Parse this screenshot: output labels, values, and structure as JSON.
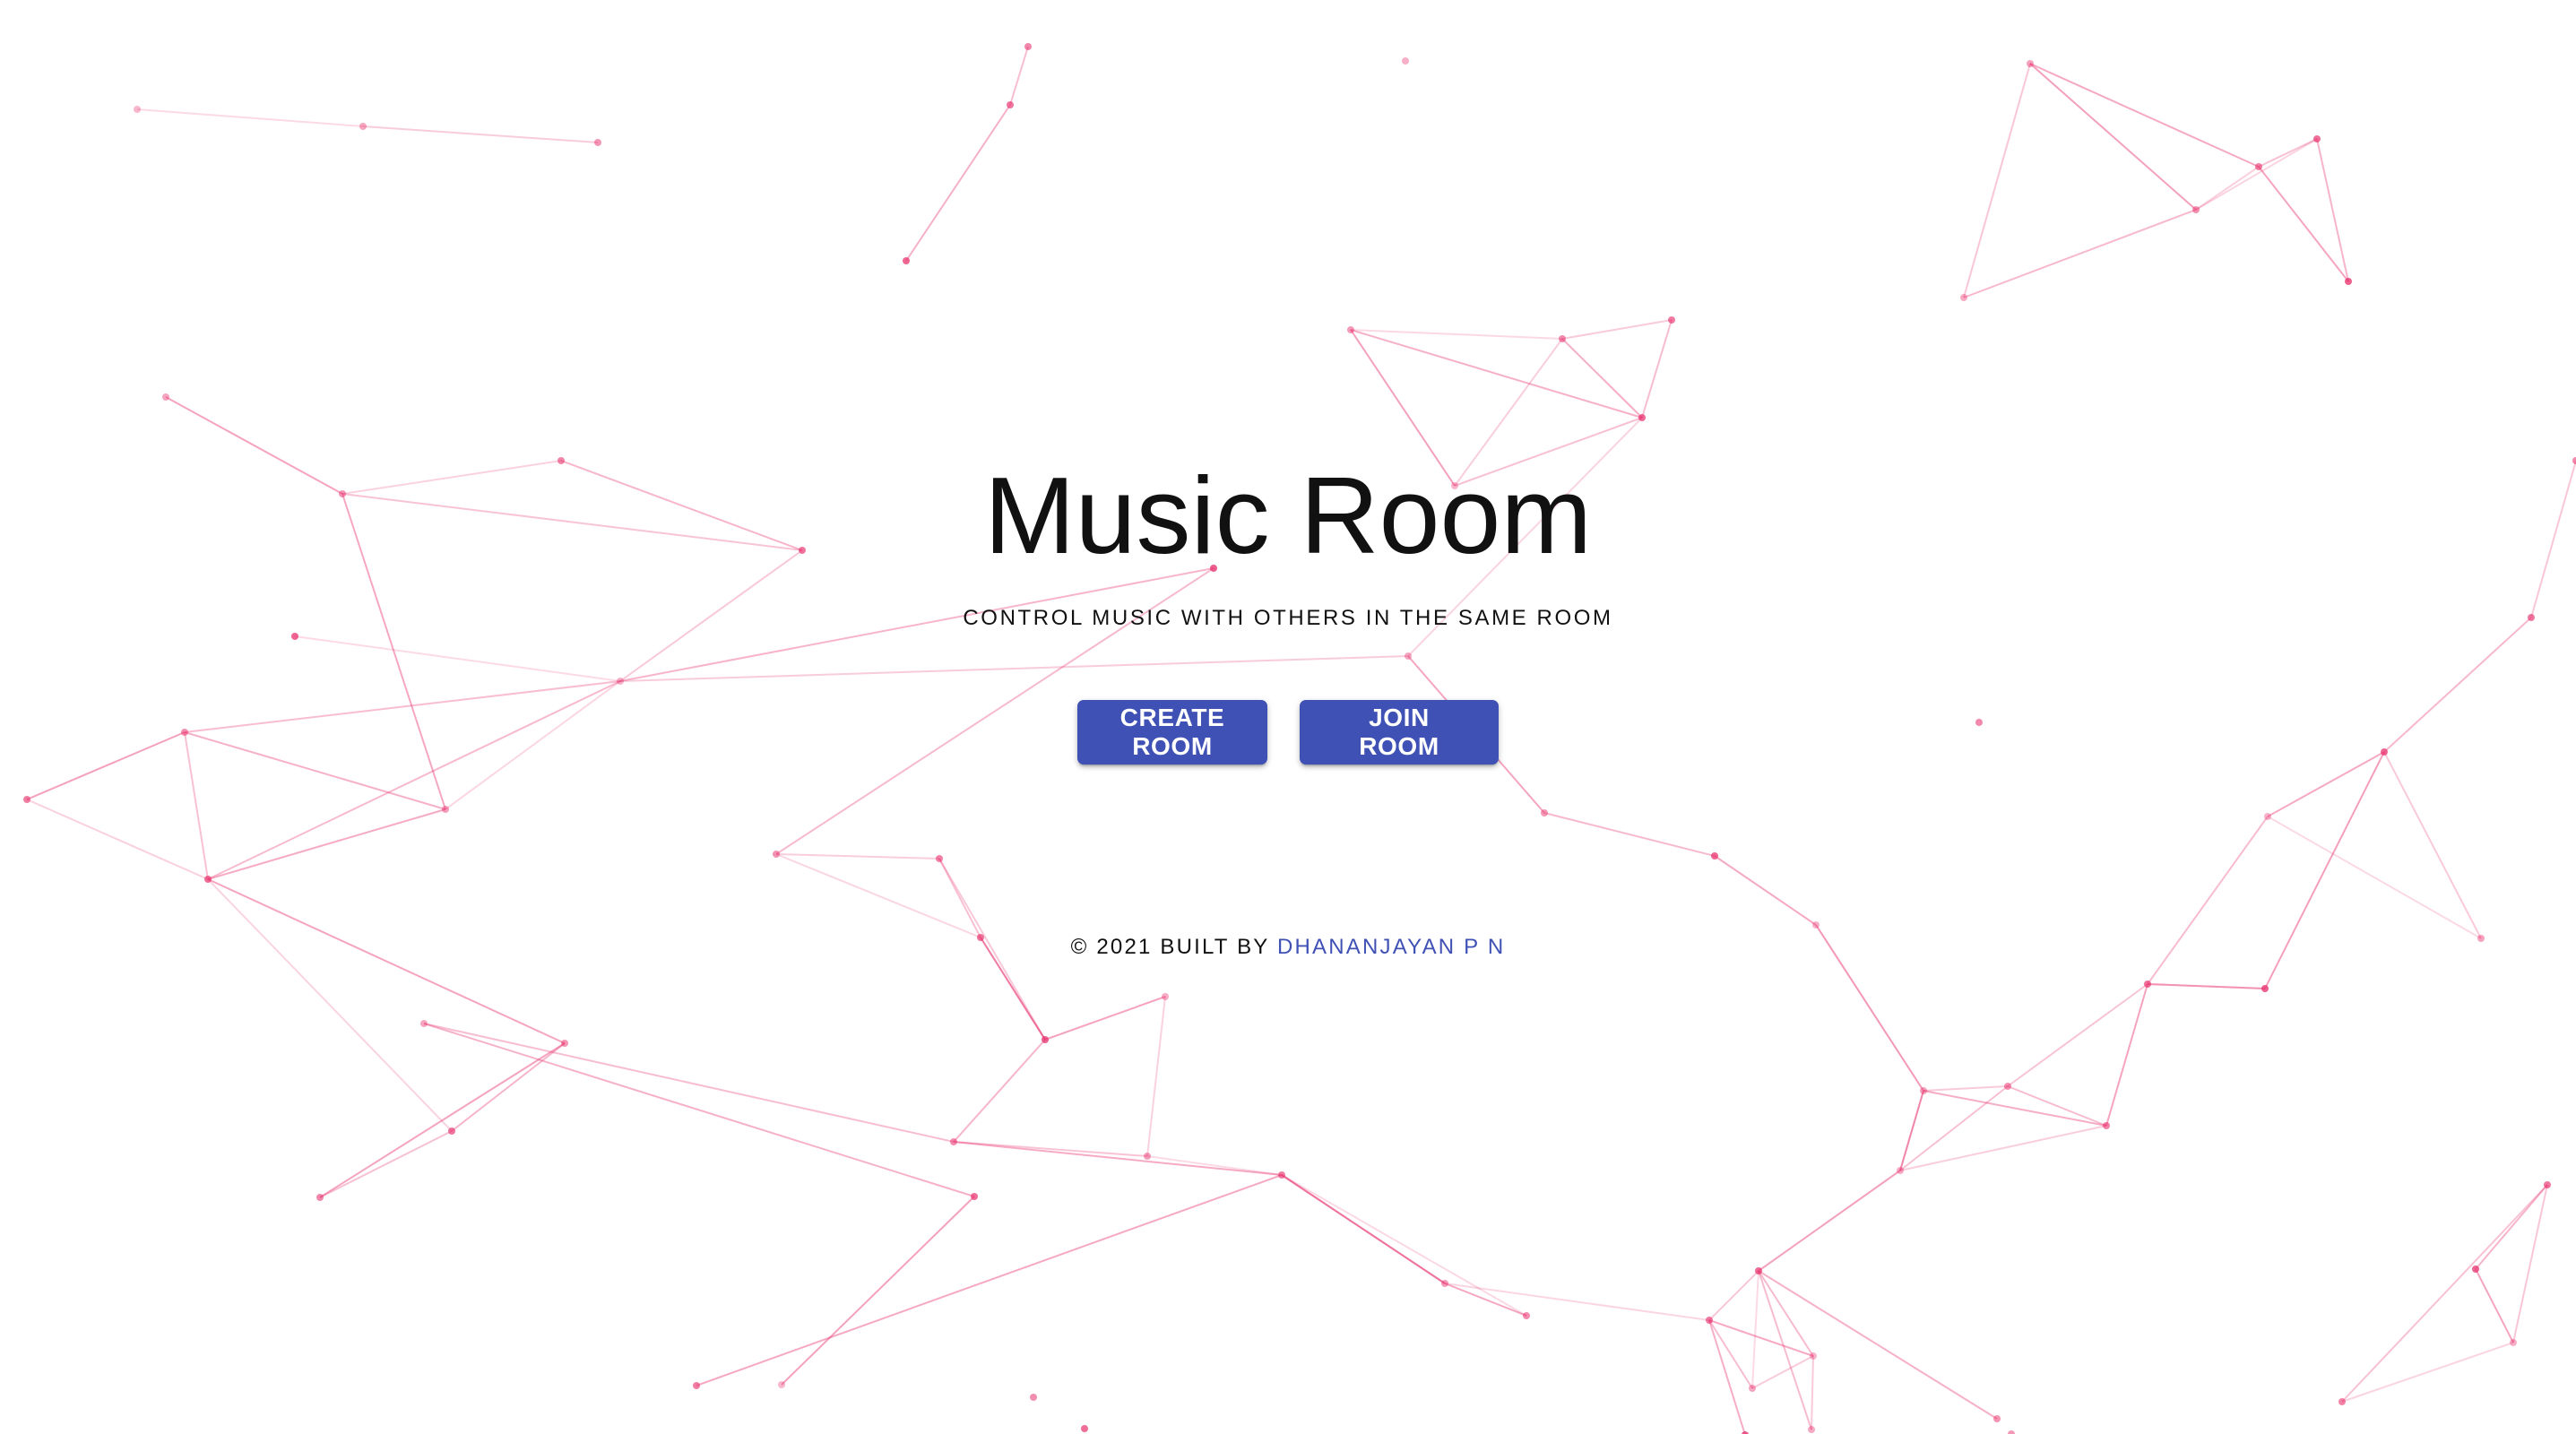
{
  "page": {
    "title": "Music Room",
    "subtitle": "CONTROL MUSIC WITH OTHERS IN THE SAME ROOM"
  },
  "buttons": {
    "create_room": "CREATE ROOM",
    "join_room": "JOIN ROOM"
  },
  "footer": {
    "prefix": "© 2021 BUILT BY ",
    "author": "DHANANJAYAN P N"
  },
  "theme": {
    "primary": "#3f51b5",
    "network_color": "#e8336e",
    "background": "#ffffff"
  }
}
